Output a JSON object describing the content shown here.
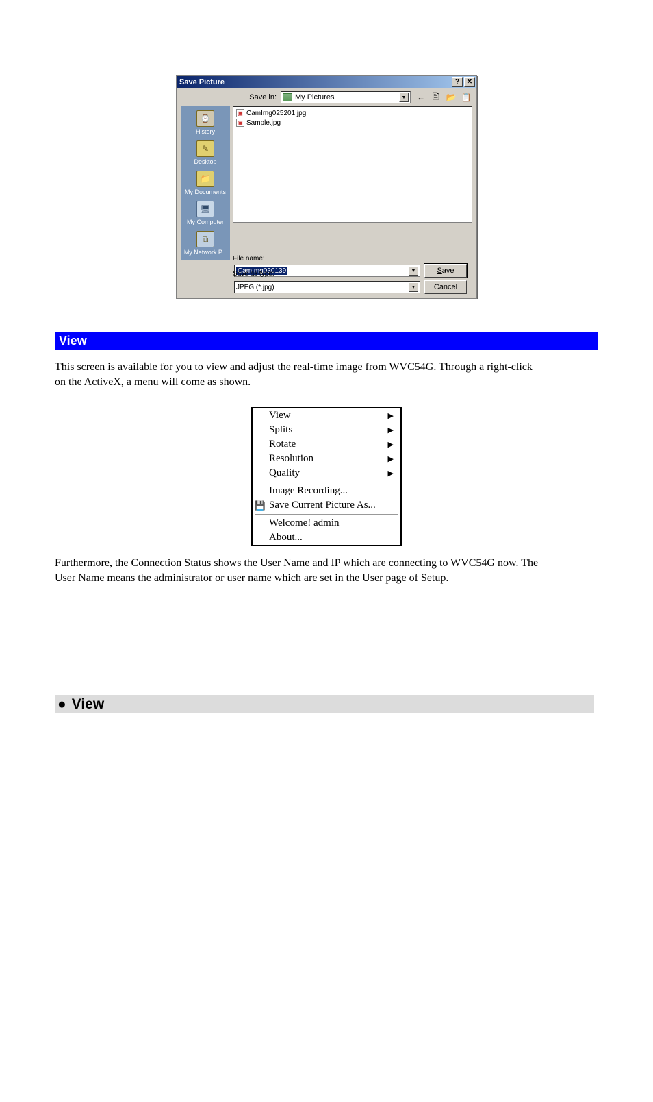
{
  "dialog": {
    "title": "Save Picture",
    "help_glyph": "?",
    "close_glyph": "✕",
    "save_in_label": "Save in:",
    "save_in_value": "My Pictures",
    "toolbar_icons": [
      "←",
      "🖹",
      "📂",
      "📋"
    ],
    "places": [
      {
        "name": "history",
        "label": "History"
      },
      {
        "name": "desktop",
        "label": "Desktop"
      },
      {
        "name": "my-documents",
        "label": "My Documents"
      },
      {
        "name": "my-computer",
        "label": "My Computer"
      },
      {
        "name": "my-network",
        "label": "My Network P..."
      }
    ],
    "files": [
      "CamImg025201.jpg",
      "Sample.jpg"
    ],
    "file_name_label": "File name:",
    "file_name_value": "CamImg030139",
    "save_as_type_label": "Save as type:",
    "save_as_type_value": "JPEG (*.jpg)",
    "save_btn_prefix": "S",
    "save_btn_rest": "ave",
    "cancel_btn": "Cancel"
  },
  "view_section": {
    "heading": "View",
    "para1": "This screen is available for you to view and adjust the real-time image from WVC54G. Through a right-click on the ActiveX, a menu will come as shown.",
    "para2": "Furthermore, the Connection Status shows the User Name and IP which are connecting to WVC54G now. The User Name means the administrator or user name which are set in the User page of Setup."
  },
  "context_menu": {
    "items_top": [
      "View",
      "Splits",
      "Rotate",
      "Resolution",
      "Quality"
    ],
    "items_mid": [
      "Image Recording...",
      "Save Current Picture As..."
    ],
    "items_bot": [
      "Welcome! admin",
      "About..."
    ],
    "arrow_glyph": "▶",
    "save_icon": "💾"
  },
  "subsection": {
    "bullet": "●",
    "title": "View"
  }
}
